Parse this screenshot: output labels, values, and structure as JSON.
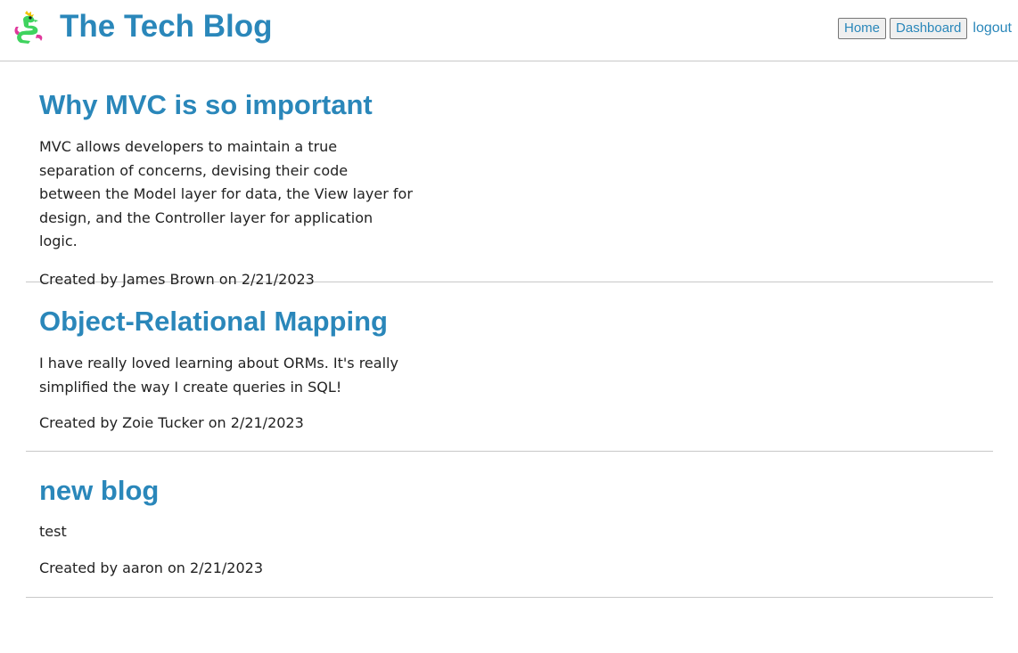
{
  "header": {
    "title": "The Tech Blog",
    "logo_icon": "dragon-icon",
    "nav": {
      "home_label": "Home",
      "dashboard_label": "Dashboard",
      "logout_label": "logout"
    }
  },
  "colors": {
    "accent": "#2a87ba",
    "text": "#222222",
    "divider": "#c8c8c8"
  },
  "posts": [
    {
      "title": "Why MVC is so important",
      "body": "MVC allows developers to maintain a true separation of concerns, devising their code between the Model layer for data, the View layer for design, and the Controller layer for application logic.",
      "meta": "Created by James Brown on 2/21/2023"
    },
    {
      "title": "Object-Relational Mapping",
      "body": "I have really loved learning about ORMs. It's really simplified the way I create queries in SQL!",
      "meta": "Created by Zoie Tucker on 2/21/2023"
    },
    {
      "title": "new blog",
      "body": "test",
      "meta": "Created by aaron on 2/21/2023"
    }
  ]
}
